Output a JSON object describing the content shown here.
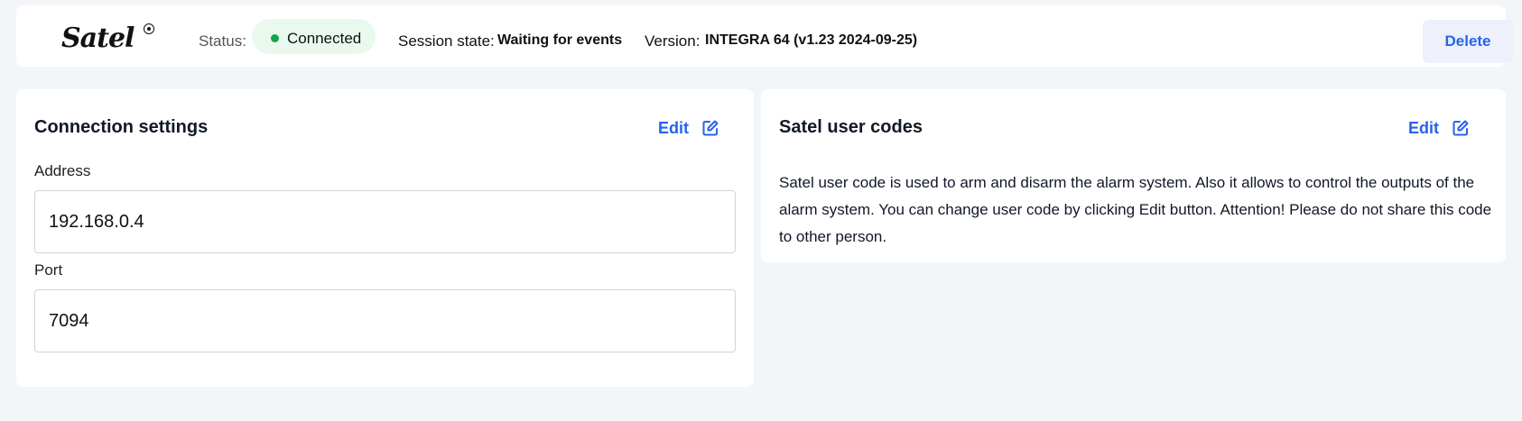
{
  "header": {
    "logo_text": "Satel",
    "status_label": "Status:",
    "status_value": "Connected",
    "status_color": "#16a34a",
    "session_label": "Session state:",
    "session_value": "Waiting for events",
    "version_label": "Version:",
    "version_value": "INTEGRA 64 (v1.23 2024-09-25)",
    "delete_label": "Delete"
  },
  "connection": {
    "title": "Connection settings",
    "edit_label": "Edit",
    "address_label": "Address",
    "address_value": "192.168.0.4",
    "port_label": "Port",
    "port_value": "7094"
  },
  "user_codes": {
    "title": "Satel user codes",
    "edit_label": "Edit",
    "description": "Satel user code is used to arm and disarm the alarm system. Also it allows to control the outputs of the alarm system. You can change user code by clicking Edit button. Attention! Please do not share this code to other person."
  },
  "accent_color": "#2563eb"
}
